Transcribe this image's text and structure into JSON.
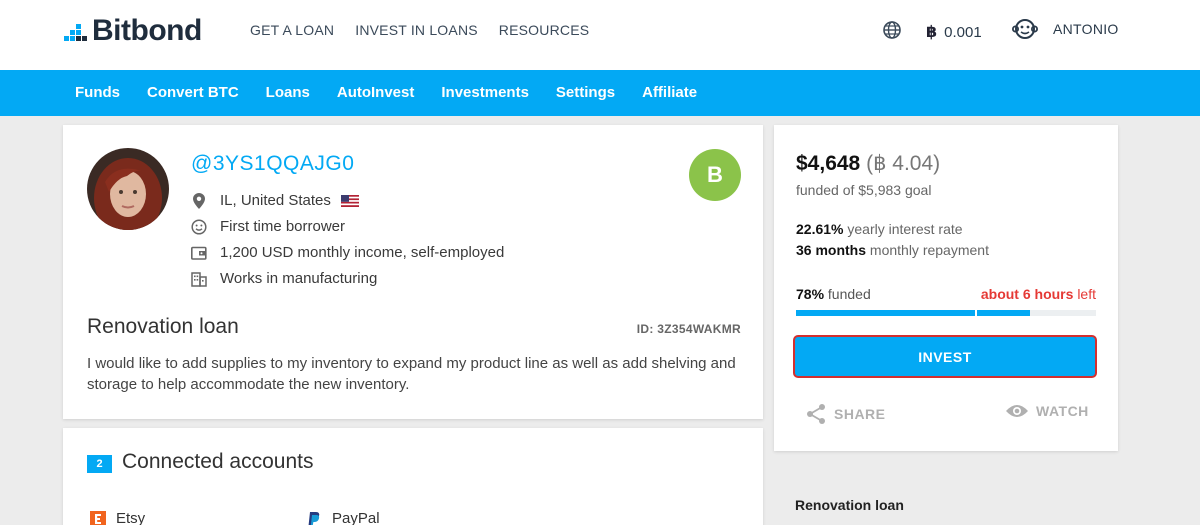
{
  "header": {
    "brand": "Bitbond",
    "nav": [
      "GET A LOAN",
      "INVEST IN LOANS",
      "RESOURCES"
    ],
    "btc_balance": "0.001",
    "username": "ANTONIO"
  },
  "subnav": [
    "Funds",
    "Convert BTC",
    "Loans",
    "AutoInvest",
    "Investments",
    "Settings",
    "Affiliate"
  ],
  "profile": {
    "handle": "@3YS1QQAJG0",
    "grade": "B",
    "location": "IL, United States",
    "borrower_status": "First time borrower",
    "income": "1,200 USD monthly income, self-employed",
    "industry": "Works in manufacturing",
    "loan_title": "Renovation loan",
    "loan_id": "ID: 3Z354WAKMR",
    "description": "I would like to add supplies to my inventory to expand my product line as well as add shelving and storage to help accommodate the new inventory."
  },
  "accounts": {
    "count": "2",
    "title": "Connected accounts",
    "items": [
      "Etsy",
      "PayPal"
    ]
  },
  "invest": {
    "funded_usd": "$4,648",
    "funded_btc_symbol": "฿",
    "funded_btc": "4.04",
    "goal": "funded of $5,983 goal",
    "rate_value": "22.61%",
    "rate_label": "yearly interest rate",
    "term_value": "36 months",
    "term_label": "monthly repayment",
    "funded_pct": "78%",
    "funded_label": "funded",
    "funded_fraction": 0.78,
    "time_strong": "about 6 hours",
    "time_rest": "left",
    "button": "INVEST",
    "share": "SHARE",
    "watch": "WATCH"
  },
  "sidebar_heading": "Renovation loan",
  "colors": {
    "primary": "#03a9f4",
    "grade": "#8bc34a",
    "alert": "#e53935"
  }
}
